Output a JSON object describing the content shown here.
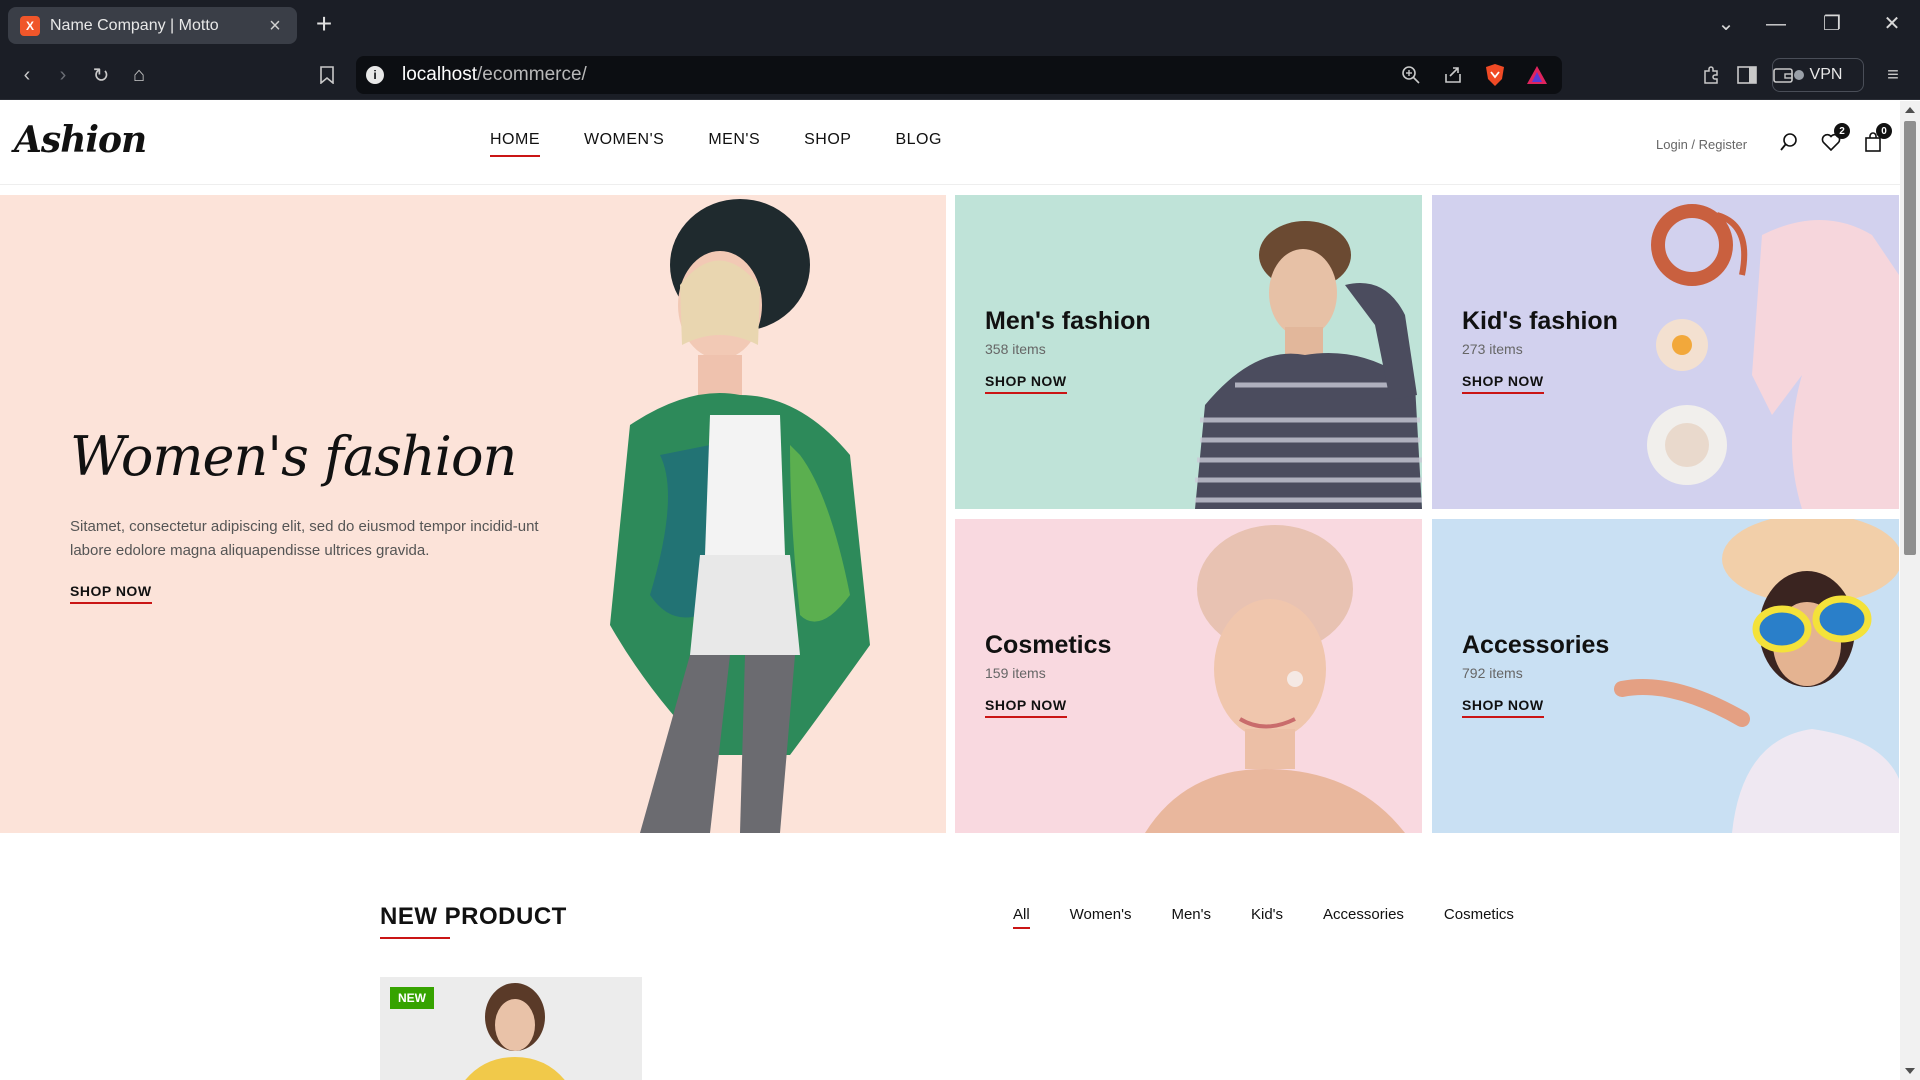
{
  "browser": {
    "tab_title": "Name Company | Motto",
    "tab_favicon": "X",
    "url_host": "localhost",
    "url_path": "/ecommerce/",
    "vpn_label": "VPN"
  },
  "site": {
    "logo": "Ashion",
    "nav": [
      "HOME",
      "WOMEN'S",
      "MEN'S",
      "SHOP",
      "BLOG"
    ],
    "login_label": "Login / Register",
    "wishlist_count": "2",
    "cart_count": "0"
  },
  "hero": {
    "title": "Women's fashion",
    "description": "Sitamet, consectetur adipiscing elit, sed do eiusmod tempor incidid-unt labore edolore magna aliquapendisse ultrices gravida.",
    "cta": "SHOP NOW"
  },
  "categories": [
    {
      "title": "Men's fashion",
      "count": "358 items",
      "cta": "SHOP NOW"
    },
    {
      "title": "Kid's fashion",
      "count": "273 items",
      "cta": "SHOP NOW"
    },
    {
      "title": "Cosmetics",
      "count": "159 items",
      "cta": "SHOP NOW"
    },
    {
      "title": "Accessories",
      "count": "792 items",
      "cta": "SHOP NOW"
    }
  ],
  "new_product": {
    "title": "NEW PRODUCT",
    "filters": [
      "All",
      "Women's",
      "Men's",
      "Kid's",
      "Accessories",
      "Cosmetics"
    ],
    "badge": "NEW"
  },
  "colors": {
    "accent": "#ca1515",
    "badge_green": "#36a300",
    "hero_bg": "#fce3d9",
    "mens_bg": "#bfe3d8",
    "kids_bg": "#d2d1ee",
    "cosmetics_bg": "#f9d9e0",
    "accessories_bg": "#c9e0f3"
  }
}
